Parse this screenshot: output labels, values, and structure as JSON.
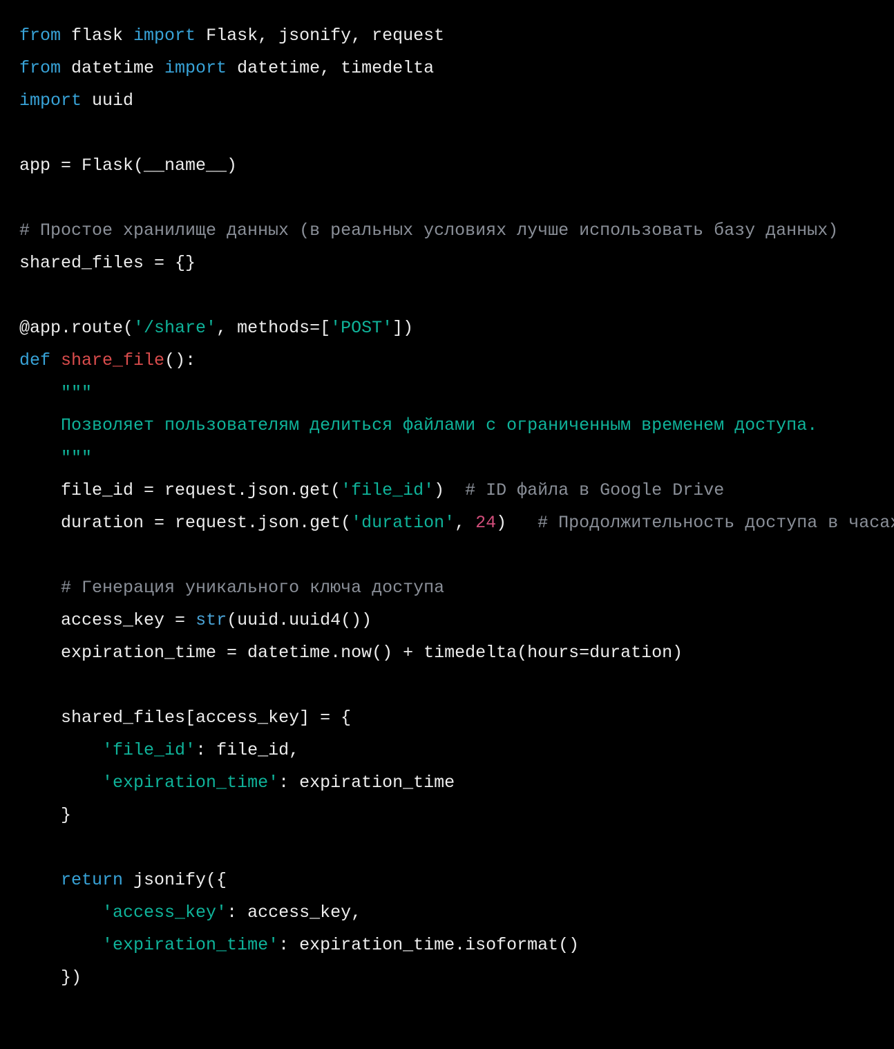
{
  "code": {
    "line1": {
      "kw_from": "from",
      "mod1": " flask ",
      "kw_import": "import",
      "rest": " Flask, jsonify, request"
    },
    "line2": {
      "kw_from": "from",
      "mod": " datetime ",
      "kw_import": "import",
      "rest": " datetime, timedelta"
    },
    "line3": {
      "kw_import": "import",
      "rest": " uuid"
    },
    "line4": "",
    "line5": "app = Flask(__name__)",
    "line6": "",
    "line7": {
      "cmt": "# Простое хранилище данных (в реальных условиях лучше использовать базу данных)"
    },
    "line8": "shared_files = {}",
    "line9": "",
    "line10": {
      "pre": "@app.route(",
      "str_route": "'/share'",
      "mid": ", methods=[",
      "str_method": "'POST'",
      "post": "])"
    },
    "line11": {
      "kw_def": "def",
      "sp": " ",
      "fn": "share_file",
      "rest": "():"
    },
    "line12": {
      "indent": "    ",
      "str": "\"\"\""
    },
    "line13": {
      "indent": "    ",
      "str": "Позволяет пользователям делиться файлами с ограниченным временем доступа."
    },
    "line14": {
      "indent": "    ",
      "str": "\"\"\""
    },
    "line15": {
      "indent": "    ",
      "pre": "file_id = request.json.get(",
      "str": "'file_id'",
      "post": ")  ",
      "cmt": "# ID файла в Google Drive"
    },
    "line16": {
      "indent": "    ",
      "pre": "duration = request.json.get(",
      "str": "'duration'",
      "mid": ", ",
      "num": "24",
      "post": ")   ",
      "cmt": "# Продолжительность доступа в часах"
    },
    "line17": "",
    "line18": {
      "indent": "    ",
      "cmt": "# Генерация уникального ключа доступа"
    },
    "line19": {
      "indent": "    ",
      "pre": "access_key = ",
      "bi": "str",
      "post": "(uuid.uuid4())"
    },
    "line20": {
      "indent": "    ",
      "text": "expiration_time = datetime.now() + timedelta(hours=duration)"
    },
    "line21": "",
    "line22": {
      "indent": "    ",
      "text": "shared_files[access_key] = {"
    },
    "line23": {
      "indent": "        ",
      "str": "'file_id'",
      "post": ": file_id,"
    },
    "line24": {
      "indent": "        ",
      "str": "'expiration_time'",
      "post": ": expiration_time"
    },
    "line25": {
      "indent": "    ",
      "text": "}"
    },
    "line26": "",
    "line27": {
      "indent": "    ",
      "kw": "return",
      "rest": " jsonify({"
    },
    "line28": {
      "indent": "        ",
      "str": "'access_key'",
      "post": ": access_key,"
    },
    "line29": {
      "indent": "        ",
      "str": "'expiration_time'",
      "post": ": expiration_time.isoformat()"
    },
    "line30": {
      "indent": "    ",
      "text": "})"
    }
  }
}
